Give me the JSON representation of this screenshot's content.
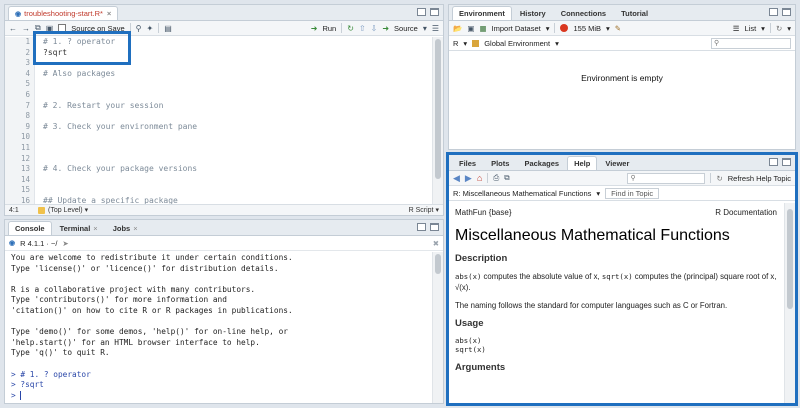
{
  "source_pane": {
    "tab_label": "troubleshooting-start.R*",
    "toolbar": {
      "source_on_save": "Source on Save",
      "run": "Run",
      "source": "Source"
    },
    "line_numbers": [
      "1",
      "2",
      "3",
      "4",
      "5",
      "6",
      "7",
      "8",
      "9",
      "10",
      "11",
      "12",
      "13",
      "14",
      "15",
      "16"
    ],
    "lines": [
      "# 1. ? operator",
      "?sqrt",
      "",
      "# Also packages",
      "",
      "",
      "# 2. Restart your session",
      "",
      "# 3. Check your environment pane",
      "",
      "",
      "",
      "# 4. Check your package versions",
      "",
      "",
      "## Update a specific package"
    ],
    "status": {
      "position": "4:1",
      "scope": "(Top Level)",
      "file_type": "R Script"
    }
  },
  "console_pane": {
    "tabs": [
      "Console",
      "Terminal",
      "Jobs"
    ],
    "path": "R 4.1.1 · ~/",
    "lines": [
      "You are welcome to redistribute it under certain conditions.",
      "Type 'license()' or 'licence()' for distribution details.",
      "",
      "R is a collaborative project with many contributors.",
      "Type 'contributors()' for more information and",
      "'citation()' on how to cite R or R packages in publications.",
      "",
      "Type 'demo()' for some demos, 'help()' for on-line help, or",
      "'help.start()' for an HTML browser interface to help.",
      "Type 'q()' to quit R.",
      "",
      "> # 1. ? operator",
      "> ?sqrt",
      "> "
    ]
  },
  "env_pane": {
    "tabs": [
      "Environment",
      "History",
      "Connections",
      "Tutorial"
    ],
    "import_label": "Import Dataset",
    "memory": "155 MiB",
    "list_label": "List",
    "lang": "R",
    "scope": "Global Environment",
    "empty_message": "Environment is empty"
  },
  "help_pane": {
    "tabs": [
      "Files",
      "Plots",
      "Packages",
      "Help",
      "Viewer"
    ],
    "refresh_label": "Refresh Help Topic",
    "topic_select": "R: Miscellaneous Mathematical Functions",
    "find_placeholder": "Find in Topic",
    "doc_left": "MathFun {base}",
    "doc_right": "R Documentation",
    "title": "Miscellaneous Mathematical Functions",
    "description_heading": "Description",
    "description_p1_a": "abs(x)",
    "description_p1_b": " computes the absolute value of x, ",
    "description_p1_c": "sqrt(x)",
    "description_p1_d": " computes the (principal) square root of x, √(x).",
    "description_p2": "The naming follows the standard for computer languages such as C or Fortran.",
    "usage_heading": "Usage",
    "usage_lines": [
      "abs(x)",
      "sqrt(x)"
    ],
    "arguments_heading": "Arguments"
  },
  "colors": {
    "highlight": "#1f6fbf",
    "console_input": "#2946a8"
  }
}
